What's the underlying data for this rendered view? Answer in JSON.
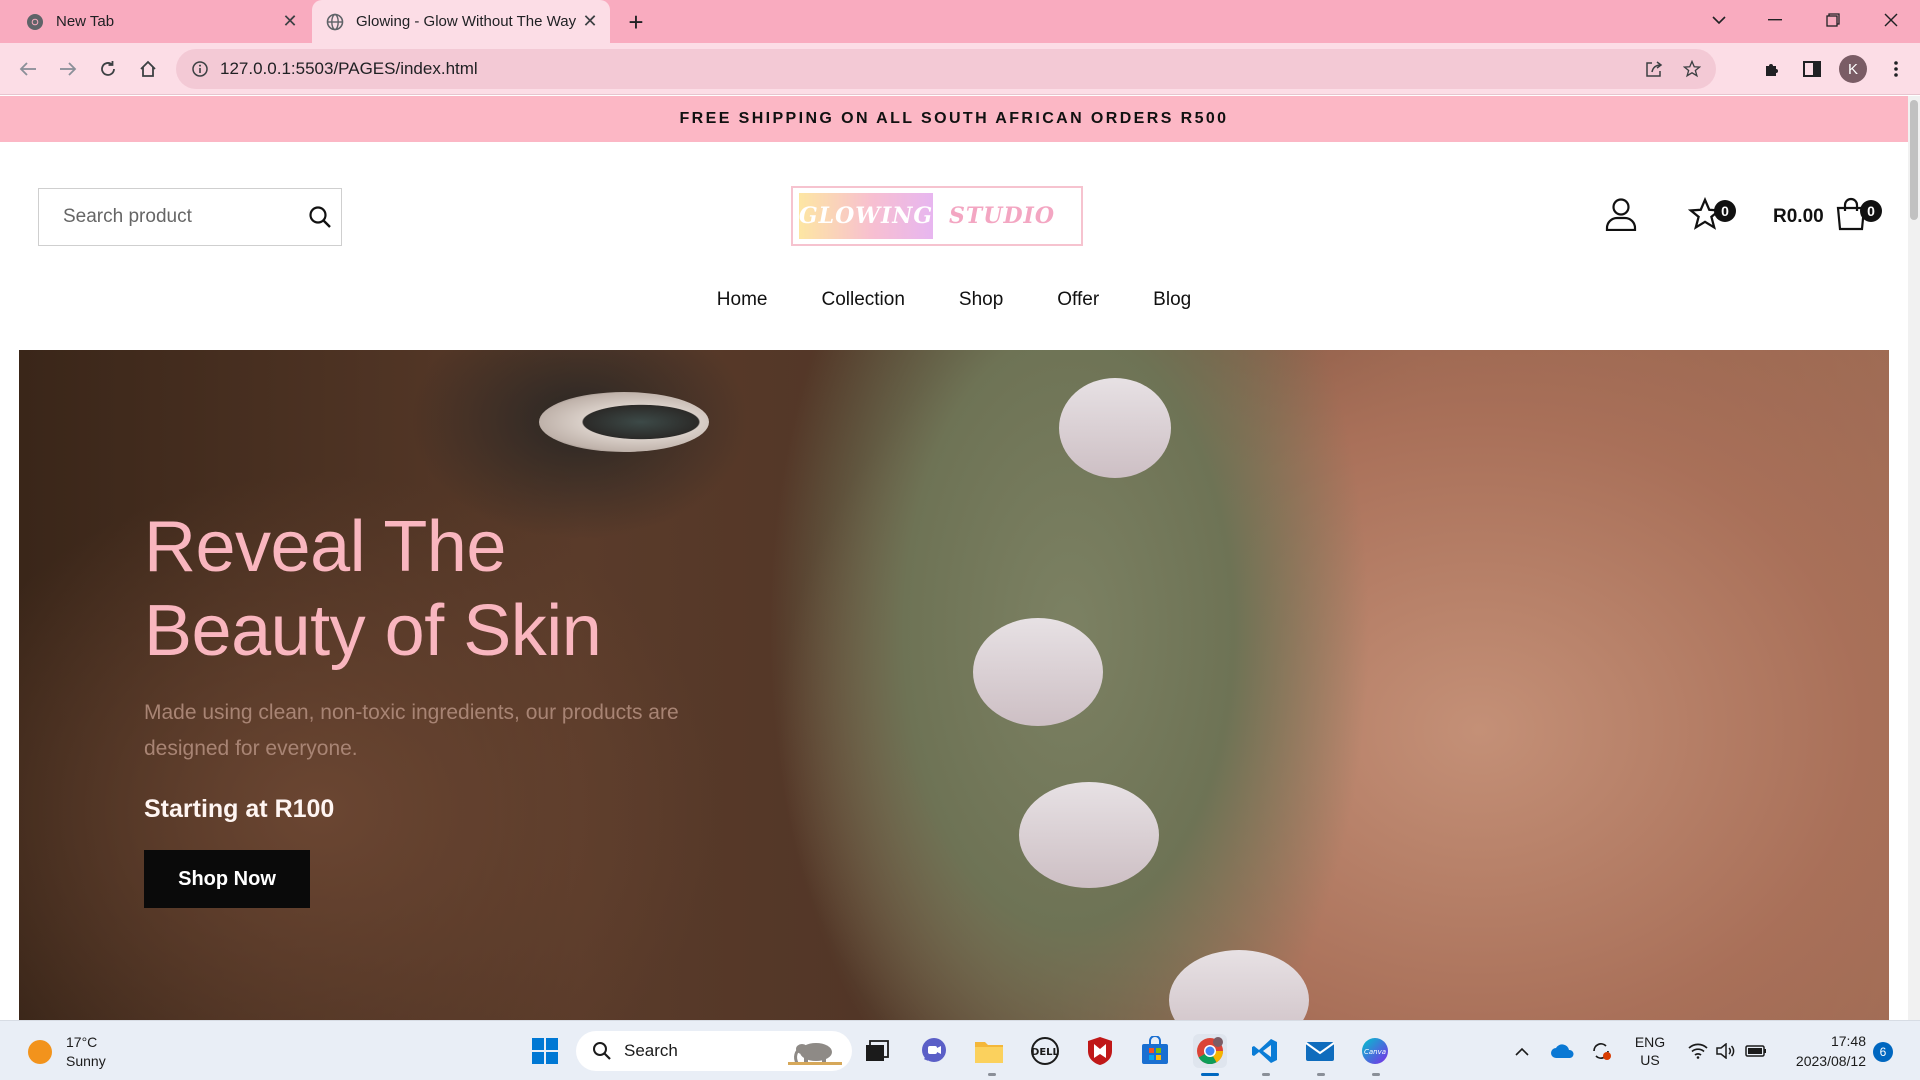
{
  "browser": {
    "tabs": [
      {
        "title": "New Tab",
        "active": false
      },
      {
        "title": "Glowing - Glow Without The Way",
        "active": true
      }
    ],
    "address": "127.0.0.1:5503/PAGES/index.html",
    "profile_initial": "K"
  },
  "page": {
    "announcement": "FREE SHIPPING ON ALL SOUTH AFRICAN ORDERS R500",
    "search": {
      "placeholder": "Search product"
    },
    "logo": {
      "part1": "GLOWING",
      "part2": "STUDIO"
    },
    "wishlist_count": "0",
    "cart": {
      "total": "R0.00",
      "count": "0"
    },
    "nav": [
      "Home",
      "Collection",
      "Shop",
      "Offer",
      "Blog"
    ],
    "hero": {
      "title_line1": "Reveal The",
      "title_line2": "Beauty of Skin",
      "subtitle": "Made using clean, non-toxic ingredients, our products are designed for everyone.",
      "price": "Starting at R100",
      "cta": "Shop Now"
    }
  },
  "taskbar": {
    "weather": {
      "temp": "17°C",
      "condition": "Sunny"
    },
    "search_label": "Search",
    "language": {
      "lang": "ENG",
      "region": "US"
    },
    "time": "17:48",
    "date": "2023/08/12",
    "notifications": "6"
  },
  "colors": {
    "tabstrip": "#f9abbf",
    "announcement_bg": "#fcb7c5",
    "hero_title": "#f9b6bf",
    "cta_bg": "#0a0a0a"
  }
}
